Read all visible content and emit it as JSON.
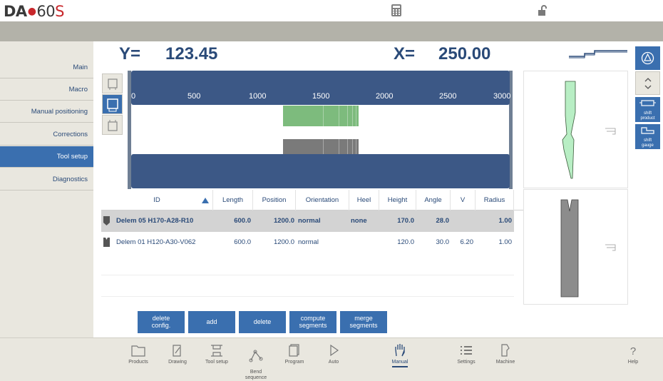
{
  "brand": {
    "name": "DA",
    "model": "60",
    "suffix": "S"
  },
  "readouts": {
    "y_label": "Y=",
    "y_value": "123.45",
    "x_label": "X=",
    "x_value": "250.00"
  },
  "sidebar": {
    "items": [
      {
        "label": "Main"
      },
      {
        "label": "Macro"
      },
      {
        "label": "Manual positioning"
      },
      {
        "label": "Corrections"
      },
      {
        "label": "Tool setup",
        "active": true
      },
      {
        "label": "Diagnostics"
      }
    ]
  },
  "scale": {
    "ticks": [
      "0",
      "500",
      "1000",
      "1500",
      "2000",
      "2500",
      "3000"
    ]
  },
  "right_panel": {
    "shift_product": "shift\nproduct",
    "shift_gauge": "shift\ngauge"
  },
  "table": {
    "columns": [
      "ID",
      "Length",
      "Position",
      "Orientation",
      "Heel",
      "Height",
      "Angle",
      "V",
      "Radius"
    ],
    "rows": [
      {
        "id": "Delem 05 H170-A28-R10",
        "length": "600.0",
        "position": "1200.0",
        "orientation": "normal",
        "heel": "none",
        "height": "170.0",
        "angle": "28.0",
        "v": "",
        "radius": "1.00",
        "selected": true,
        "type": "punch"
      },
      {
        "id": "Delem 01 H120-A30-V062",
        "length": "600.0",
        "position": "1200.0",
        "orientation": "normal",
        "heel": "",
        "height": "120.0",
        "angle": "30.0",
        "v": "6.20",
        "radius": "1.00",
        "selected": false,
        "type": "die"
      }
    ]
  },
  "actions": [
    {
      "label": "delete\nconfig."
    },
    {
      "label": "add"
    },
    {
      "label": "delete"
    },
    {
      "label": "compute\nsegments"
    },
    {
      "label": "merge\nsegments"
    }
  ],
  "bottom_nav": [
    {
      "label": "Products",
      "icon": "folder-icon"
    },
    {
      "label": "Drawing",
      "icon": "pencil-icon"
    },
    {
      "label": "Tool setup",
      "icon": "tools-icon"
    },
    {
      "label": "Bend\nsequence",
      "icon": "bend-icon"
    },
    {
      "label": "Program",
      "icon": "program-icon"
    },
    {
      "label": "Auto",
      "icon": "play-icon"
    },
    {
      "label": "Manual",
      "icon": "hand-icon",
      "active": true
    },
    {
      "label": "Settings",
      "icon": "list-icon"
    },
    {
      "label": "Machine",
      "icon": "machine-icon"
    },
    {
      "label": "Help",
      "icon": "question-icon"
    }
  ],
  "colors": {
    "accent": "#3a6faf",
    "text": "#2a4a78",
    "punch": "#b8eec4",
    "die": "#8c8c8c"
  }
}
